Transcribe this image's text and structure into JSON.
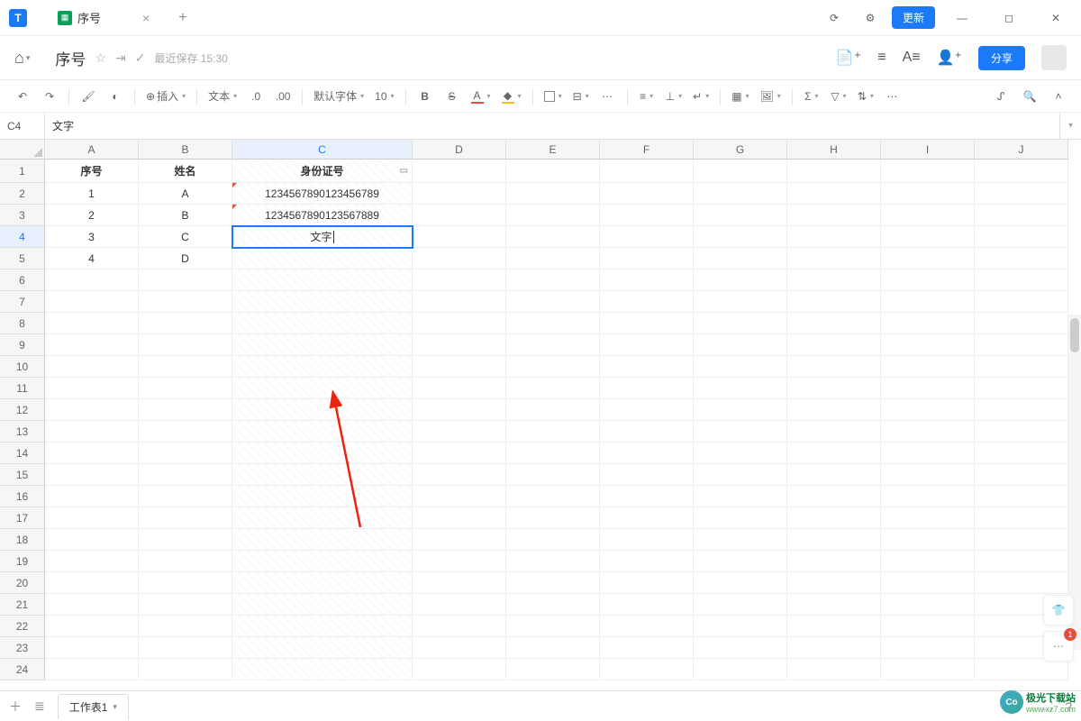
{
  "titlebar": {
    "tab_title": "序号",
    "update_label": "更新"
  },
  "docbar": {
    "title": "序号",
    "save_status": "最近保存 15:30",
    "share_label": "分享"
  },
  "toolbar": {
    "insert": "插入",
    "format": "文本",
    "decimals": ".0",
    "decimals2": ".00",
    "font": "默认字体",
    "font_size": "10",
    "bold": "B",
    "strike": "S",
    "fontcolor": "A",
    "fillcolor": "⬚",
    "sum": "Σ"
  },
  "namebox": {
    "ref": "C4",
    "formula": "文字"
  },
  "columns": [
    "A",
    "B",
    "C",
    "D",
    "E",
    "F",
    "G",
    "H",
    "I",
    "J"
  ],
  "row_headers": {
    "A": "序号",
    "B": "姓名",
    "C": "身份证号"
  },
  "rows": [
    {
      "n": "1",
      "A": "1",
      "B": "A",
      "C": "1234567890123456789"
    },
    {
      "n": "2",
      "A": "2",
      "B": "B",
      "C": "1234567890123567889"
    },
    {
      "n": "3",
      "A": "3",
      "B": "C",
      "C": "文字"
    },
    {
      "n": "4",
      "A": "4",
      "B": "D",
      "C": ""
    }
  ],
  "sheet": {
    "name": "工作表1"
  },
  "float": {
    "badge": "1"
  },
  "watermark": {
    "text": "极光下载站",
    "url": "www.xz7.com"
  }
}
